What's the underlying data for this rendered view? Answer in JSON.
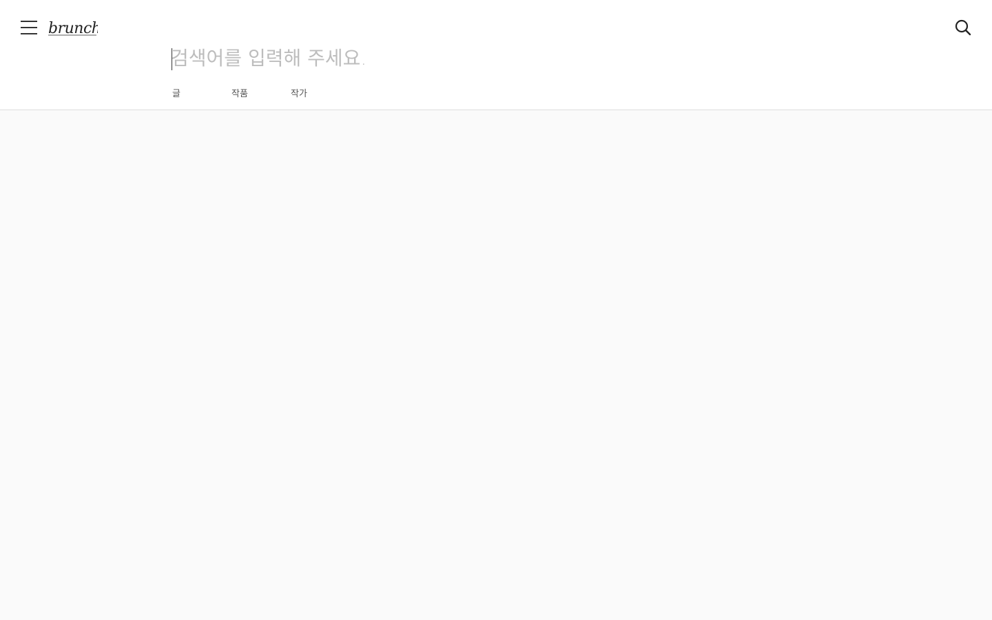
{
  "header": {
    "menu_icon": "hamburger-menu-icon",
    "logo_text": "brunch",
    "search_icon": "search-icon"
  },
  "search": {
    "value": "",
    "placeholder": "검색어를 입력해 주세요."
  },
  "tabs": [
    {
      "label": "글"
    },
    {
      "label": "작품"
    },
    {
      "label": "작가"
    }
  ],
  "colors": {
    "header_bg": "#ffffff",
    "page_bg": "#fafafa",
    "divider": "#dcdcdc",
    "placeholder": "#bdbdbd",
    "text": "#555555"
  }
}
